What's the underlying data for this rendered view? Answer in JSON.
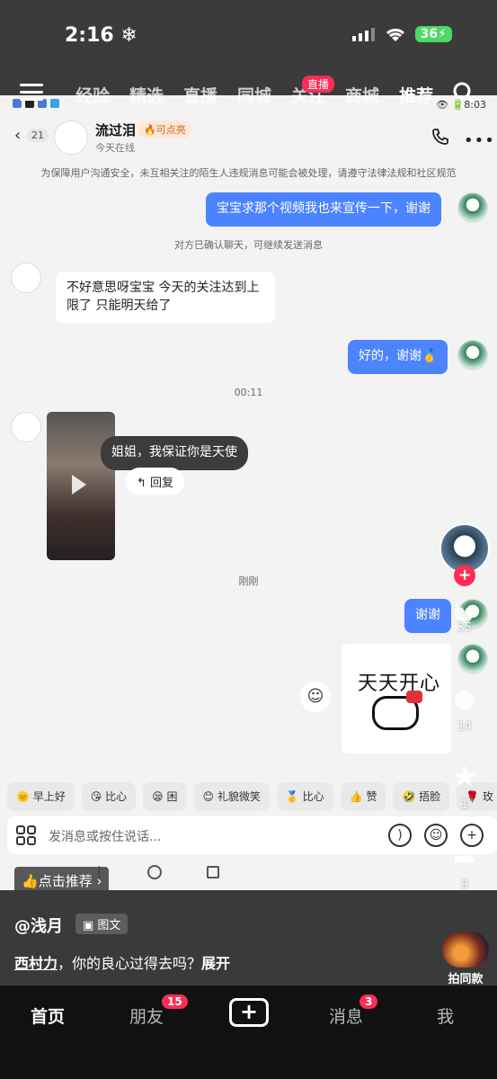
{
  "os": {
    "time": "2:16",
    "battery": "36"
  },
  "nav": {
    "tabs": [
      "经验",
      "精选",
      "直播",
      "同城",
      "关注",
      "商城",
      "推荐"
    ],
    "live_badge": "直播"
  },
  "chat": {
    "status_right": "8:03",
    "unread": "21",
    "contact_name": "流过泪",
    "flame_label": "可点亮",
    "online": "今天在线",
    "safety_notice": "为保障用户沟通安全，未互相关注的陌生人违规消息可能会被处理，请遵守法律法规和社区规范",
    "msg1": "宝宝求那个视频我也来宣传一下，谢谢",
    "confirm_notice": "对方已确认聊天，可继续发送消息",
    "msg2_line1": "不好意思呀宝宝 今天的关注达到上",
    "msg2_line2": "限了 只能明天给了",
    "msg3": "好的，谢谢",
    "msg3_emoji": "🥇",
    "time1": "00:11",
    "video_caption": "姐姐，我保证你是天使",
    "reply_label": "回复",
    "time2": "刚刚",
    "msg4": "谢谢",
    "sticker_text": "天天开心",
    "quick_replies": [
      {
        "emoji": "🌞",
        "label": "早上好"
      },
      {
        "emoji": "😘",
        "label": "比心"
      },
      {
        "emoji": "😪",
        "label": "困"
      },
      {
        "emoji": "😊",
        "label": "礼貌微笑"
      },
      {
        "emoji": "🥇",
        "label": "比心"
      },
      {
        "emoji": "👍",
        "label": "赞"
      },
      {
        "emoji": "🤣",
        "label": "捂脸"
      },
      {
        "emoji": "🌹",
        "label": "玫"
      }
    ],
    "input_placeholder": "发消息或按住说话..."
  },
  "rail": {
    "likes": "35",
    "comments": "14",
    "favorites": "1",
    "shares": "9"
  },
  "recommend_label": "点击推荐",
  "caption": {
    "author": "@浅月",
    "tag": "图文",
    "mention": "西村力",
    "text": "，你的良心过得去吗？",
    "expand": "展开",
    "same_label": "拍同款"
  },
  "tabbar": {
    "home": "首页",
    "friends": "朋友",
    "friends_badge": "15",
    "messages": "消息",
    "messages_badge": "3",
    "me": "我"
  }
}
